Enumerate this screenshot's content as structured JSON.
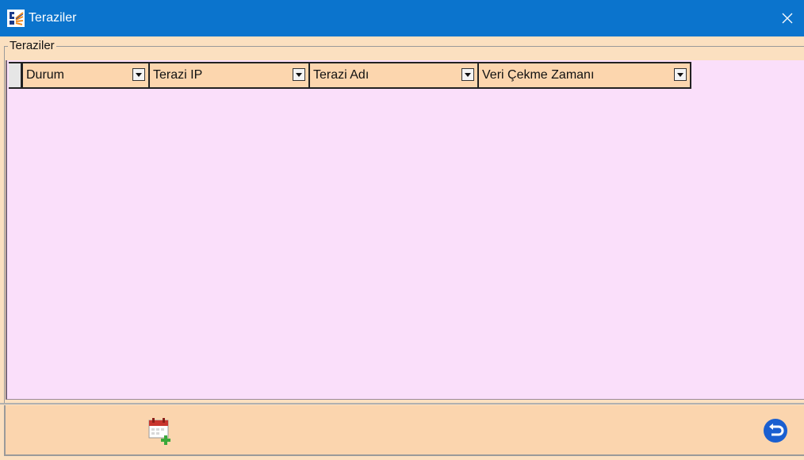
{
  "window": {
    "title": "Teraziler"
  },
  "group": {
    "label": "Teraziler"
  },
  "grid": {
    "columns": [
      {
        "label": "Durum"
      },
      {
        "label": "Terazi IP"
      },
      {
        "label": "Terazi Adı"
      },
      {
        "label": "Veri Çekme Zamanı"
      }
    ],
    "rows": []
  },
  "toolbar": {
    "add_icon": "calendar-add-icon",
    "back_icon": "return-icon"
  },
  "colors": {
    "titlebar": "#0b74cd",
    "grid_background": "#fadffa",
    "header_background": "#fcd6ae",
    "toolbar_background": "#fbd5ae",
    "back_button": "#1a5fd0",
    "add_plus": "#3aa83a"
  }
}
